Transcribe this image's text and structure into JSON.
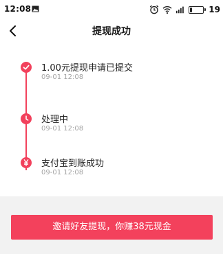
{
  "status_bar": {
    "time": "12:08",
    "battery_level": "19",
    "battery_fraction": 0.19,
    "icons": [
      "gallery-icon",
      "alarm-icon",
      "wifi-icon",
      "signal-icon",
      "battery-icon"
    ]
  },
  "nav": {
    "title": "提现成功",
    "back_icon": "chevron-left-icon"
  },
  "timeline": {
    "steps": [
      {
        "label": "1.00元提现申请已提交",
        "time": "09-01 12:08",
        "icon": "check-icon"
      },
      {
        "label": "处理中",
        "time": "09-01 12:08",
        "icon": "clock-icon"
      },
      {
        "label": "支付宝到账成功",
        "time": "09-01 12:08",
        "icon": "yuan-icon"
      }
    ]
  },
  "invite_button": {
    "label": "邀请好友提现，你赚38元现金"
  },
  "colors": {
    "accent": "#f2415c",
    "background": "#f2f2f2",
    "card": "#ffffff",
    "muted_text": "#a3a3a3"
  }
}
